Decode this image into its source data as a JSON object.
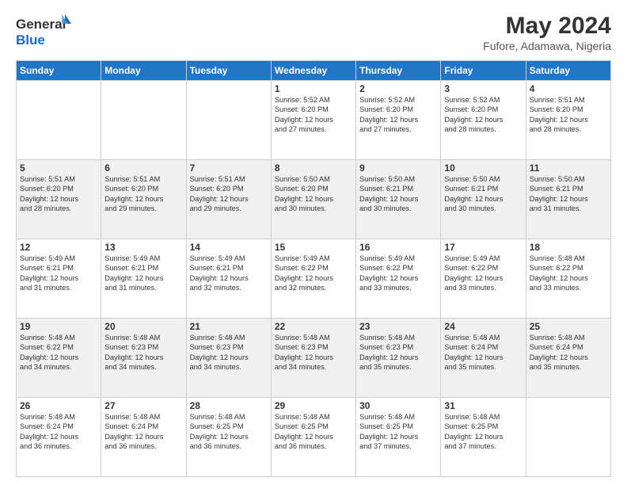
{
  "header": {
    "logo_line1": "General",
    "logo_line2": "Blue",
    "month_year": "May 2024",
    "location": "Fufore, Adamawa, Nigeria"
  },
  "days_of_week": [
    "Sunday",
    "Monday",
    "Tuesday",
    "Wednesday",
    "Thursday",
    "Friday",
    "Saturday"
  ],
  "weeks": [
    [
      {
        "day": "",
        "info": ""
      },
      {
        "day": "",
        "info": ""
      },
      {
        "day": "",
        "info": ""
      },
      {
        "day": "1",
        "info": "Sunrise: 5:52 AM\nSunset: 6:20 PM\nDaylight: 12 hours\nand 27 minutes."
      },
      {
        "day": "2",
        "info": "Sunrise: 5:52 AM\nSunset: 6:20 PM\nDaylight: 12 hours\nand 27 minutes."
      },
      {
        "day": "3",
        "info": "Sunrise: 5:52 AM\nSunset: 6:20 PM\nDaylight: 12 hours\nand 28 minutes."
      },
      {
        "day": "4",
        "info": "Sunrise: 5:51 AM\nSunset: 6:20 PM\nDaylight: 12 hours\nand 28 minutes."
      }
    ],
    [
      {
        "day": "5",
        "info": "Sunrise: 5:51 AM\nSunset: 6:20 PM\nDaylight: 12 hours\nand 28 minutes."
      },
      {
        "day": "6",
        "info": "Sunrise: 5:51 AM\nSunset: 6:20 PM\nDaylight: 12 hours\nand 29 minutes."
      },
      {
        "day": "7",
        "info": "Sunrise: 5:51 AM\nSunset: 6:20 PM\nDaylight: 12 hours\nand 29 minutes."
      },
      {
        "day": "8",
        "info": "Sunrise: 5:50 AM\nSunset: 6:20 PM\nDaylight: 12 hours\nand 30 minutes."
      },
      {
        "day": "9",
        "info": "Sunrise: 5:50 AM\nSunset: 6:21 PM\nDaylight: 12 hours\nand 30 minutes."
      },
      {
        "day": "10",
        "info": "Sunrise: 5:50 AM\nSunset: 6:21 PM\nDaylight: 12 hours\nand 30 minutes."
      },
      {
        "day": "11",
        "info": "Sunrise: 5:50 AM\nSunset: 6:21 PM\nDaylight: 12 hours\nand 31 minutes."
      }
    ],
    [
      {
        "day": "12",
        "info": "Sunrise: 5:49 AM\nSunset: 6:21 PM\nDaylight: 12 hours\nand 31 minutes."
      },
      {
        "day": "13",
        "info": "Sunrise: 5:49 AM\nSunset: 6:21 PM\nDaylight: 12 hours\nand 31 minutes."
      },
      {
        "day": "14",
        "info": "Sunrise: 5:49 AM\nSunset: 6:21 PM\nDaylight: 12 hours\nand 32 minutes."
      },
      {
        "day": "15",
        "info": "Sunrise: 5:49 AM\nSunset: 6:22 PM\nDaylight: 12 hours\nand 32 minutes."
      },
      {
        "day": "16",
        "info": "Sunrise: 5:49 AM\nSunset: 6:22 PM\nDaylight: 12 hours\nand 33 minutes."
      },
      {
        "day": "17",
        "info": "Sunrise: 5:49 AM\nSunset: 6:22 PM\nDaylight: 12 hours\nand 33 minutes."
      },
      {
        "day": "18",
        "info": "Sunrise: 5:48 AM\nSunset: 6:22 PM\nDaylight: 12 hours\nand 33 minutes."
      }
    ],
    [
      {
        "day": "19",
        "info": "Sunrise: 5:48 AM\nSunset: 6:22 PM\nDaylight: 12 hours\nand 34 minutes."
      },
      {
        "day": "20",
        "info": "Sunrise: 5:48 AM\nSunset: 6:23 PM\nDaylight: 12 hours\nand 34 minutes."
      },
      {
        "day": "21",
        "info": "Sunrise: 5:48 AM\nSunset: 6:23 PM\nDaylight: 12 hours\nand 34 minutes."
      },
      {
        "day": "22",
        "info": "Sunrise: 5:48 AM\nSunset: 6:23 PM\nDaylight: 12 hours\nand 34 minutes."
      },
      {
        "day": "23",
        "info": "Sunrise: 5:48 AM\nSunset: 6:23 PM\nDaylight: 12 hours\nand 35 minutes."
      },
      {
        "day": "24",
        "info": "Sunrise: 5:48 AM\nSunset: 6:24 PM\nDaylight: 12 hours\nand 35 minutes."
      },
      {
        "day": "25",
        "info": "Sunrise: 5:48 AM\nSunset: 6:24 PM\nDaylight: 12 hours\nand 35 minutes."
      }
    ],
    [
      {
        "day": "26",
        "info": "Sunrise: 5:48 AM\nSunset: 6:24 PM\nDaylight: 12 hours\nand 36 minutes."
      },
      {
        "day": "27",
        "info": "Sunrise: 5:48 AM\nSunset: 6:24 PM\nDaylight: 12 hours\nand 36 minutes."
      },
      {
        "day": "28",
        "info": "Sunrise: 5:48 AM\nSunset: 6:25 PM\nDaylight: 12 hours\nand 36 minutes."
      },
      {
        "day": "29",
        "info": "Sunrise: 5:48 AM\nSunset: 6:25 PM\nDaylight: 12 hours\nand 36 minutes."
      },
      {
        "day": "30",
        "info": "Sunrise: 5:48 AM\nSunset: 6:25 PM\nDaylight: 12 hours\nand 37 minutes."
      },
      {
        "day": "31",
        "info": "Sunrise: 5:48 AM\nSunset: 6:25 PM\nDaylight: 12 hours\nand 37 minutes."
      },
      {
        "day": "",
        "info": ""
      }
    ]
  ]
}
